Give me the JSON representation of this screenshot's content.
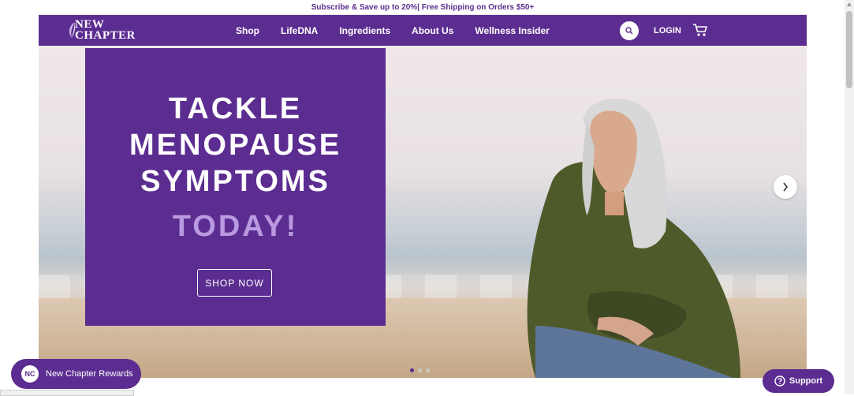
{
  "promo_bar": {
    "text": "Subscribe & Save up to 20%| Free Shipping on Orders $50+"
  },
  "header": {
    "logo_line1": "NEW",
    "logo_line2": "CHAPTER",
    "nav": [
      "Shop",
      "LifeDNA",
      "Ingredients",
      "About Us",
      "Wellness Insider"
    ],
    "login": "LOGIN",
    "search_icon": "search-icon",
    "cart_icon": "cart-icon"
  },
  "hero": {
    "headline_lines": [
      "TACKLE",
      "MENOPAUSE",
      "SYMPTOMS"
    ],
    "accent": "TODAY!",
    "cta": "SHOP NOW",
    "slides_total": 3,
    "active_slide": 1
  },
  "widgets": {
    "rewards_label": "New Chapter Rewards",
    "rewards_badge": "NC",
    "support_label": "Support"
  },
  "colors": {
    "brand_purple": "#5c2d91",
    "accent_lavender": "#b99ae0",
    "white": "#ffffff"
  }
}
